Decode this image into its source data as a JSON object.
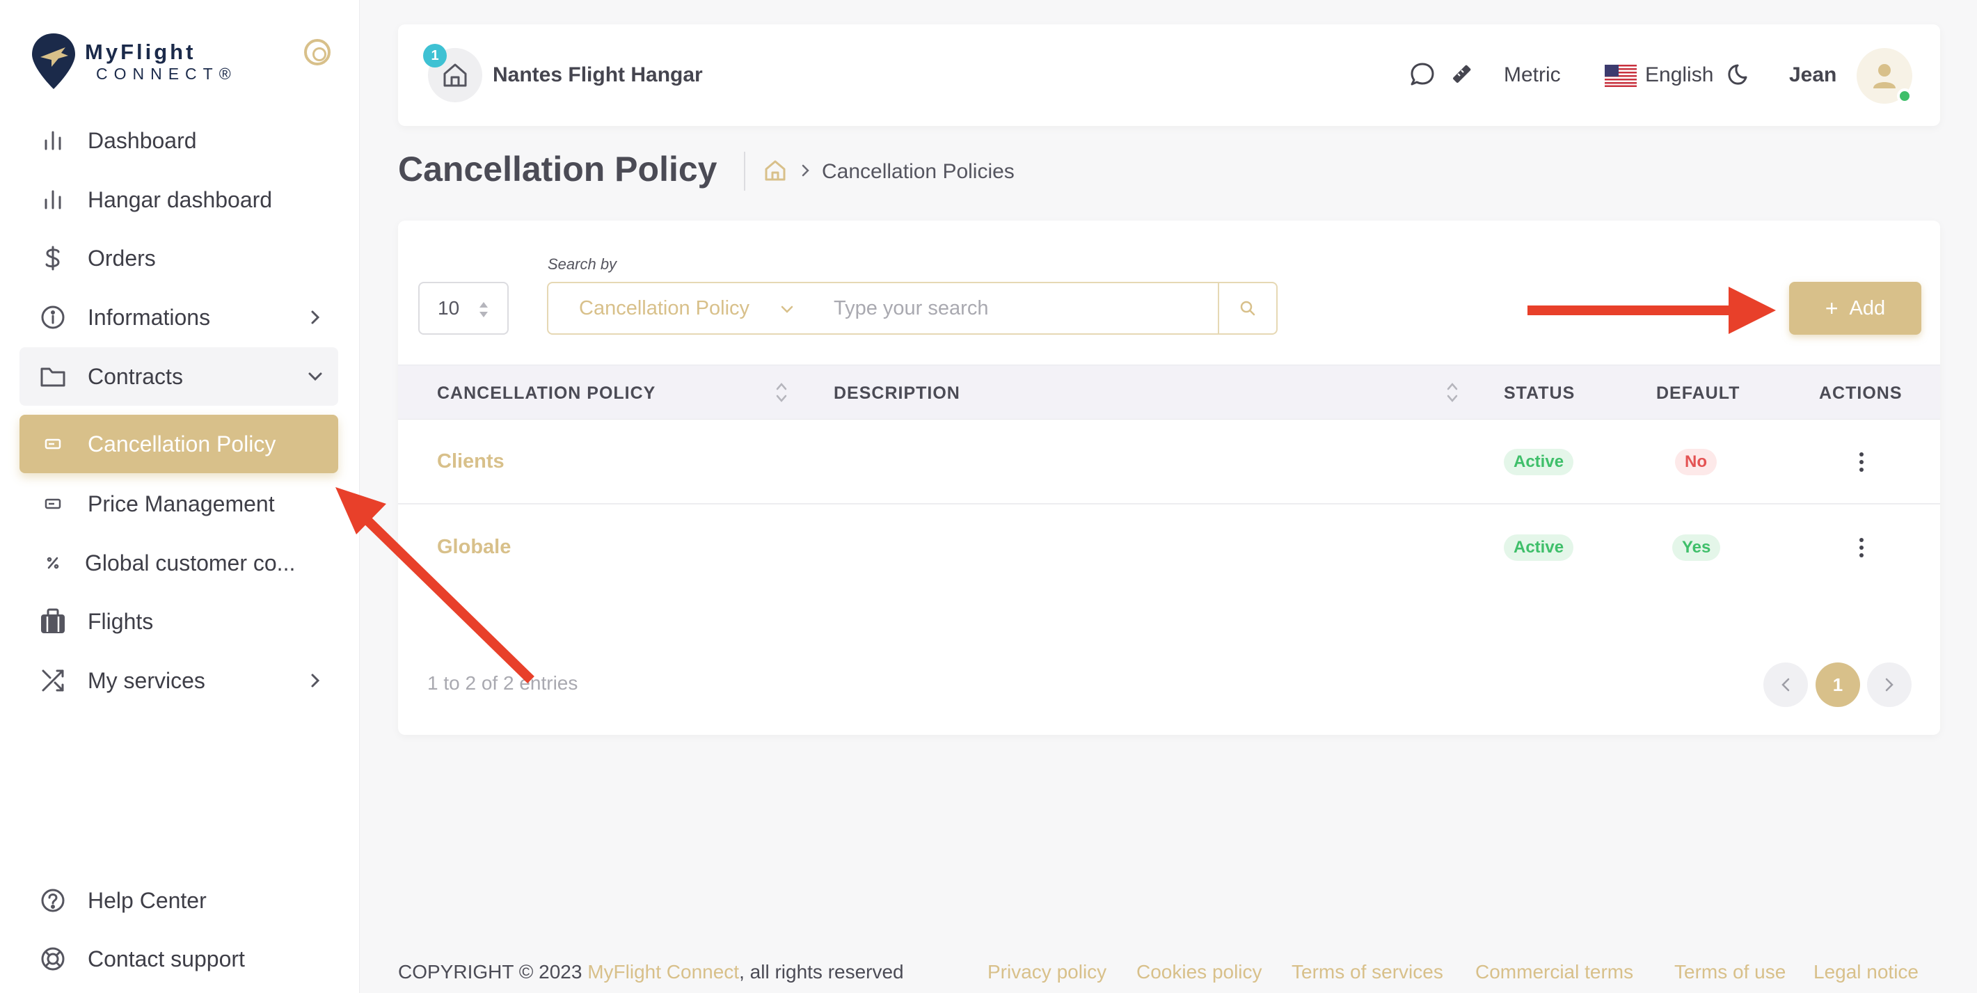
{
  "app": {
    "logo_line1": "MyFlight",
    "logo_line2": "CONNECT®"
  },
  "sidebar": {
    "items": [
      {
        "label": "Dashboard",
        "icon": "bar-chart-icon"
      },
      {
        "label": "Hangar dashboard",
        "icon": "bar-chart-icon"
      },
      {
        "label": "Orders",
        "icon": "dollar-icon"
      },
      {
        "label": "Informations",
        "icon": "info-circle-icon"
      },
      {
        "label": "Contracts",
        "icon": "folder-icon"
      },
      {
        "label": "Cancellation Policy",
        "icon": "card-icon"
      },
      {
        "label": "Price Management",
        "icon": "card-icon"
      },
      {
        "label": "Global customer co...",
        "icon": "percent-icon"
      },
      {
        "label": "Flights",
        "icon": "briefcase-icon"
      },
      {
        "label": "My services",
        "icon": "shuffle-icon"
      }
    ],
    "bottom": [
      {
        "label": "Help Center",
        "icon": "help-circle-icon"
      },
      {
        "label": "Contact support",
        "icon": "lifebuoy-icon"
      }
    ]
  },
  "topbar": {
    "hangar_badge": "1",
    "hangar_name": "Nantes Flight Hangar",
    "units": "Metric",
    "language": "English",
    "user_name": "Jean"
  },
  "page": {
    "title": "Cancellation Policy",
    "breadcrumb": "Cancellation Policies"
  },
  "table_controls": {
    "per_page": "10",
    "search_label": "Search by",
    "search_field": "Cancellation Policy",
    "search_placeholder": "Type your search",
    "add_label": "Add"
  },
  "table": {
    "columns": [
      "CANCELLATION POLICY",
      "DESCRIPTION",
      "STATUS",
      "DEFAULT",
      "ACTIONS"
    ],
    "rows": [
      {
        "name": "Clients",
        "description": "",
        "status": "Active",
        "default": "No"
      },
      {
        "name": "Globale",
        "description": "",
        "status": "Active",
        "default": "Yes"
      }
    ],
    "entries_text": "1 to 2 of 2 entries",
    "current_page": "1"
  },
  "footer": {
    "copyright": "COPYRIGHT © 2023 ",
    "brand": "MyFlight Connect",
    "rights": ", all rights reserved",
    "links": [
      "Privacy policy",
      "Cookies policy",
      "Terms of services",
      "Commercial terms",
      "Terms of use",
      "Legal notice"
    ]
  },
  "colors": {
    "accent": "#d8c08a",
    "annotation_arrow": "#e8402a",
    "success": "#3fbf6a",
    "danger": "#e45353"
  }
}
